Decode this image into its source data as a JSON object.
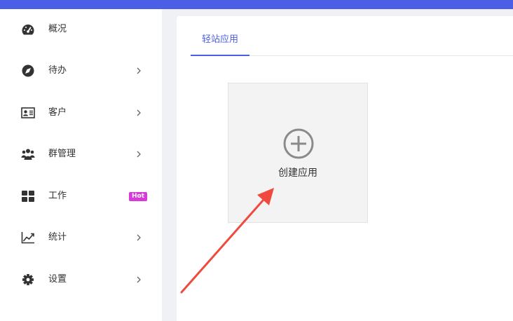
{
  "sidebar": {
    "items": [
      {
        "label": "概况",
        "icon": "dashboard-gauge-icon",
        "has_chevron": false
      },
      {
        "label": "待办",
        "icon": "compass-icon",
        "has_chevron": true
      },
      {
        "label": "客户",
        "icon": "contact-card-icon",
        "has_chevron": true
      },
      {
        "label": "群管理",
        "icon": "user-group-icon",
        "has_chevron": true
      },
      {
        "label": "工作",
        "icon": "grid-tiles-icon",
        "has_chevron": false,
        "badge": "Hot"
      },
      {
        "label": "统计",
        "icon": "line-chart-icon",
        "has_chevron": true
      },
      {
        "label": "设置",
        "icon": "gear-icon",
        "has_chevron": true
      }
    ]
  },
  "main": {
    "tabs": [
      {
        "label": "轻站应用",
        "active": true
      }
    ],
    "create_card": {
      "label": "创建应用",
      "icon": "plus-circle-icon"
    }
  },
  "colors": {
    "accent": "#4a5fe6",
    "badge": "#d63ad9",
    "annotation_arrow": "#f04a3e"
  },
  "annotation": {
    "icon": "red-arrow-icon"
  }
}
